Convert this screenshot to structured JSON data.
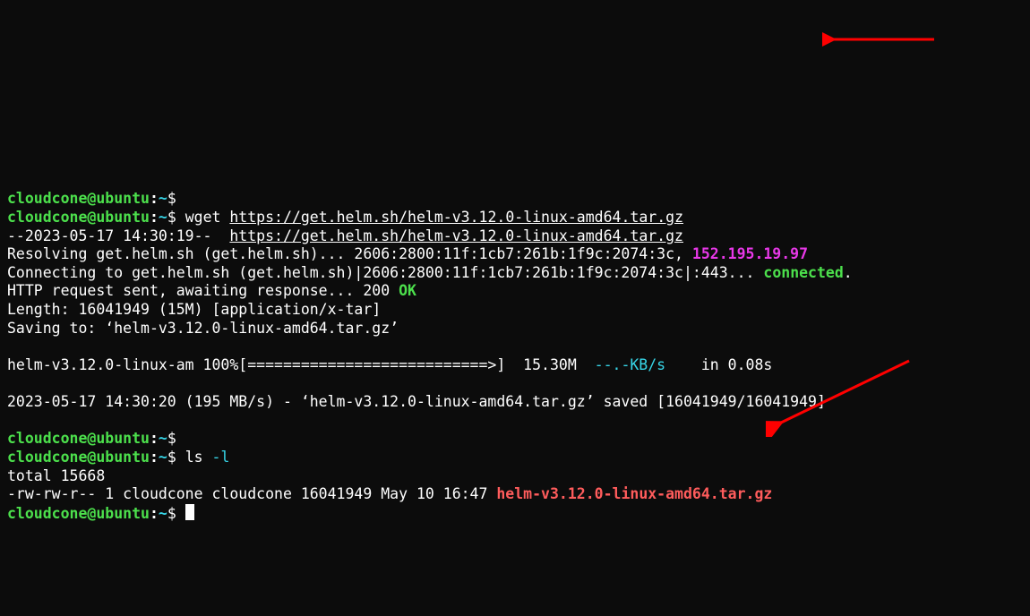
{
  "prompt": {
    "user": "cloudcone@ubuntu",
    "sep": ":",
    "path": "~",
    "end": "$"
  },
  "cmd1": "wget ",
  "url": "https://get.helm.sh/helm-v3.12.0-linux-amd64.tar.gz",
  "line_ts": "--2023-05-17 14:30:19--  ",
  "resolve_a": "Resolving get.helm.sh (get.helm.sh)... 2606:2800:11f:1cb7:261b:1f9c:2074:3c, ",
  "resolve_ip": "152.195.19.97",
  "connect_a": "Connecting to get.helm.sh (get.helm.sh)|2606:2800:11f:1cb7:261b:1f9c:2074:3c|:443... ",
  "connected": "connected",
  "dot": ".",
  "http_line_a": "HTTP request sent, awaiting response... 200 ",
  "ok": "OK",
  "length": "Length: 16041949 (15M) [application/x-tar]",
  "saving": "Saving to: ‘helm-v3.12.0-linux-amd64.tar.gz’",
  "prog_name": "helm-v3.12.0-linux-am 100%[===========================>]  15.30M  ",
  "prog_speed": "--.-KB/s",
  "prog_tail": "    in 0.08s   ",
  "saved": "2023-05-17 14:30:20 (195 MB/s) - ‘helm-v3.12.0-linux-amd64.tar.gz’ saved [16041949/16041949]",
  "cmd2_a": "ls ",
  "cmd2_b": "-l",
  "total": "total 15668",
  "ls_a": "-rw-rw-r-- 1 cloudcone cloudcone 16041949 May 10 16:47 ",
  "ls_file": "helm-v3.12.0-linux-amd64.tar.gz"
}
